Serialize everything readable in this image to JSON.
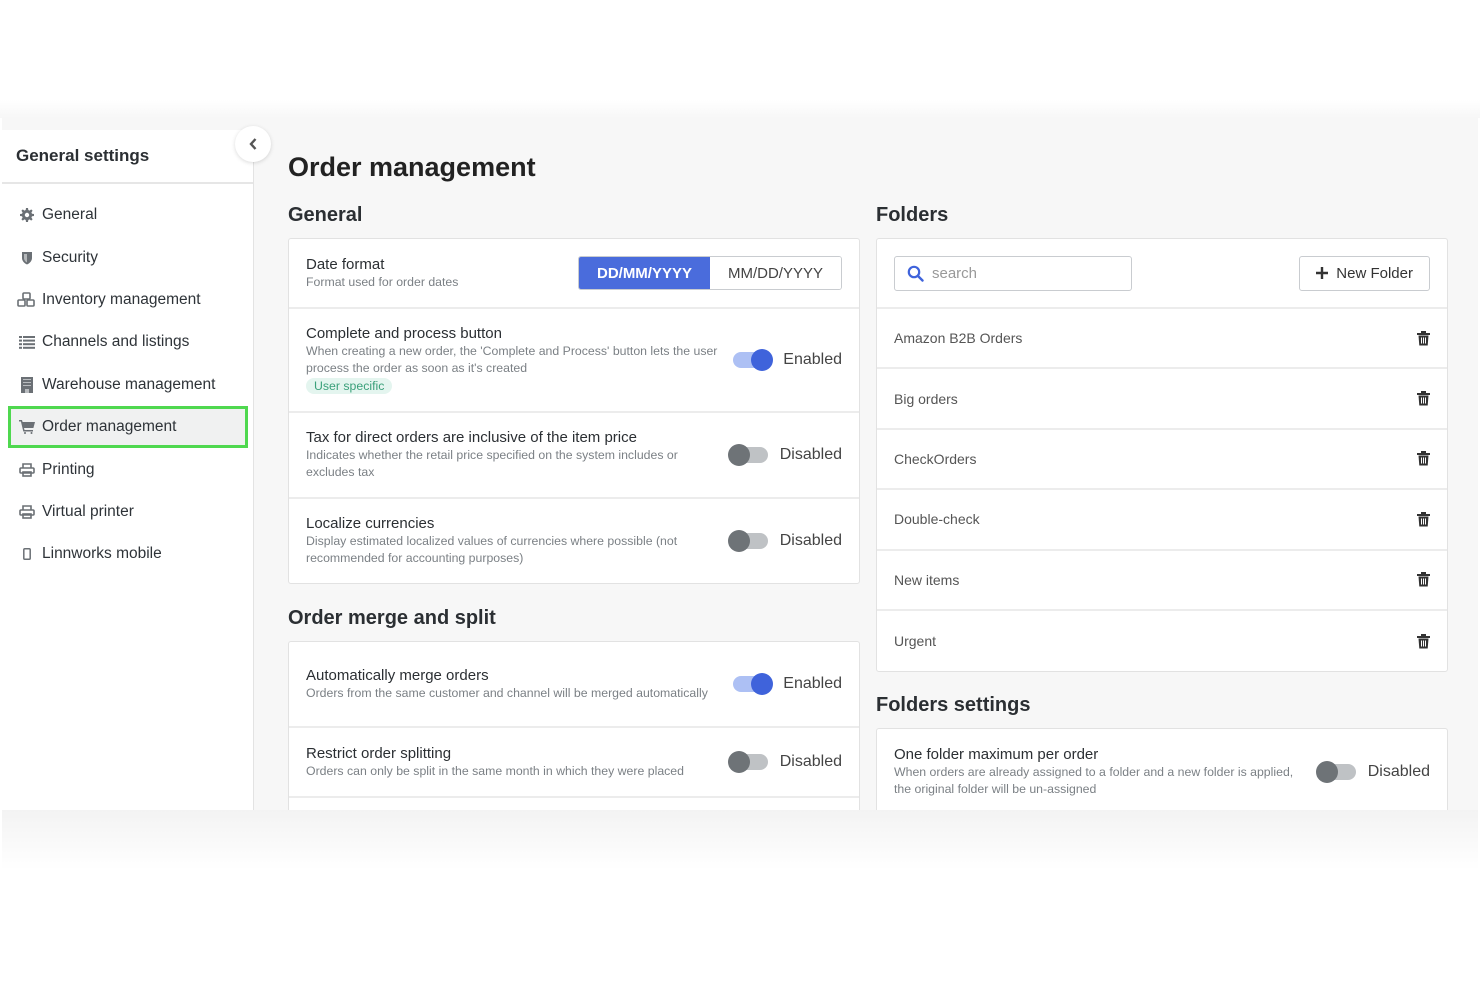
{
  "sidebar": {
    "title": "General settings",
    "collapse_icon": "chevron-left-icon",
    "items": [
      {
        "label": "General",
        "icon": "gear-icon"
      },
      {
        "label": "Security",
        "icon": "shield-icon"
      },
      {
        "label": "Inventory management",
        "icon": "cubes-icon"
      },
      {
        "label": "Channels and listings",
        "icon": "list-icon"
      },
      {
        "label": "Warehouse management",
        "icon": "building-icon"
      },
      {
        "label": "Order management",
        "icon": "cart-icon",
        "active": true
      },
      {
        "label": "Printing",
        "icon": "printer-icon"
      },
      {
        "label": "Virtual printer",
        "icon": "printer-icon"
      },
      {
        "label": "Linnworks mobile",
        "icon": "mobile-icon"
      }
    ]
  },
  "main": {
    "title": "Order management",
    "general": {
      "heading": "General",
      "date_format": {
        "title": "Date format",
        "desc": "Format used for order dates",
        "options": [
          "DD/MM/YYYY",
          "MM/DD/YYYY"
        ],
        "selected": "DD/MM/YYYY"
      },
      "settings": [
        {
          "title": "Complete and process button",
          "desc": "When creating a new order, the 'Complete and Process' button lets the user process the order as soon as it's created",
          "badge": "User specific",
          "state": "Enabled"
        },
        {
          "title": "Tax for direct orders are inclusive of the item price",
          "desc": "Indicates whether the retail price specified on the system includes or excludes tax",
          "state": "Disabled"
        },
        {
          "title": "Localize currencies",
          "desc": "Display estimated localized values of currencies where possible (not recommended for accounting purposes)",
          "state": "Disabled"
        }
      ]
    },
    "merge_split": {
      "heading": "Order merge and split",
      "settings": [
        {
          "title": "Automatically merge orders",
          "desc": "Orders from the same customer and channel will be merged automatically",
          "state": "Enabled"
        },
        {
          "title": "Restrict order splitting",
          "desc": "Orders can only be split in the same month in which they were placed",
          "state": "Disabled"
        }
      ]
    },
    "folders": {
      "heading": "Folders",
      "search_placeholder": "search",
      "search_value": "",
      "new_folder_label": "New Folder",
      "items": [
        "Amazon B2B Orders",
        "Big orders",
        "CheckOrders",
        "Double-check",
        "New items",
        "Urgent"
      ]
    },
    "folder_settings": {
      "heading": "Folders settings",
      "settings": [
        {
          "title": "One folder maximum per order",
          "desc": "When orders are already assigned to a folder and a new folder is applied, the original folder will be un-assigned",
          "state": "Disabled"
        }
      ]
    }
  },
  "colors": {
    "accent": "#4a6cdc",
    "active_highlight": "#4fd84f",
    "badge_text": "#3aa07a",
    "badge_bg": "#e4f5ef"
  }
}
